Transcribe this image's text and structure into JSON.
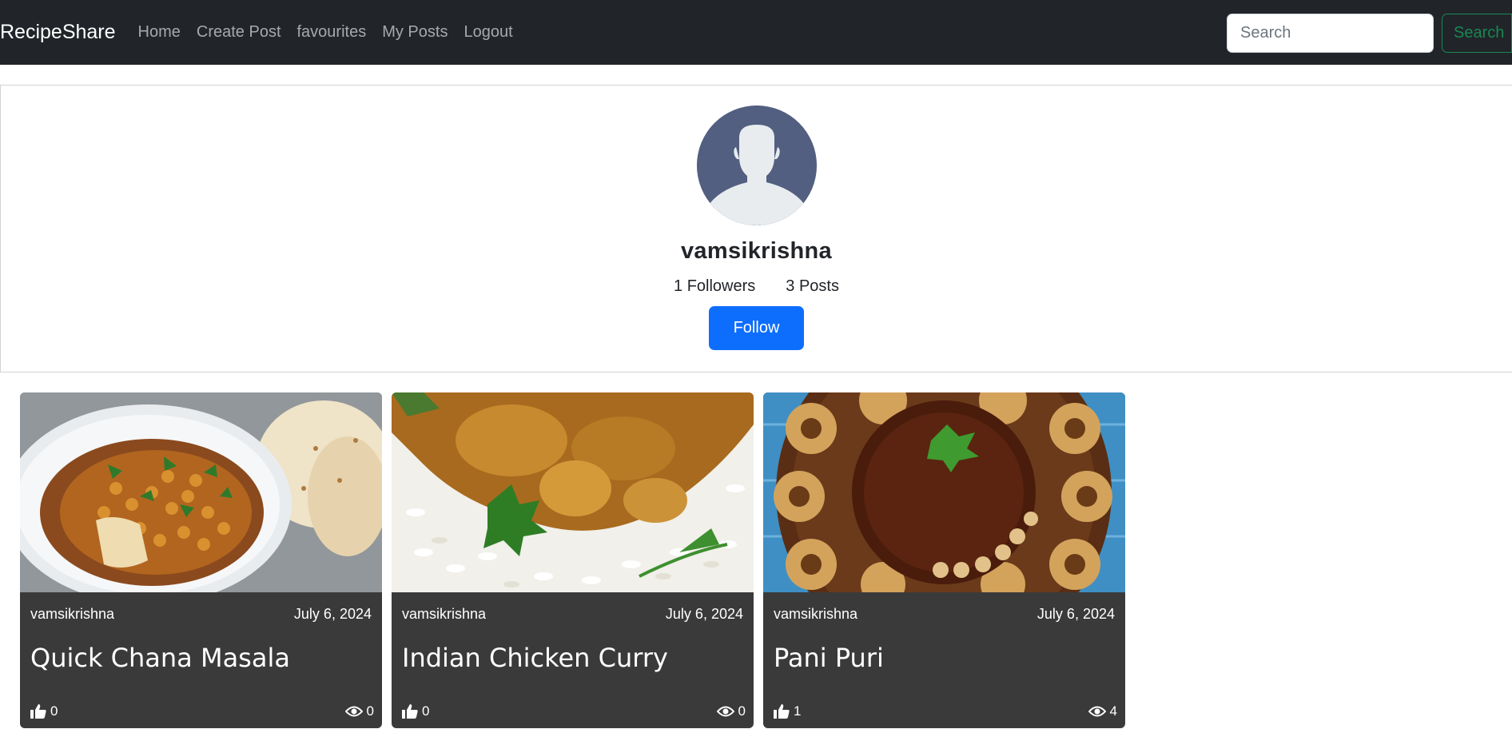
{
  "navbar": {
    "brand": "RecipeShare",
    "links": [
      "Home",
      "Create Post",
      "favourites",
      "My Posts",
      "Logout"
    ],
    "search_placeholder": "Search",
    "search_button": "Search"
  },
  "profile": {
    "username": "vamsikrishna",
    "followers": "1 Followers",
    "posts": "3 Posts",
    "follow_label": "Follow"
  },
  "posts": [
    {
      "author": "vamsikrishna",
      "date": "July 6, 2024",
      "title": "Quick Chana Masala",
      "likes": "0",
      "views": "0"
    },
    {
      "author": "vamsikrishna",
      "date": "July 6, 2024",
      "title": "Indian Chicken Curry",
      "likes": "0",
      "views": "0"
    },
    {
      "author": "vamsikrishna",
      "date": "July 6, 2024",
      "title": "Pani Puri",
      "likes": "1",
      "views": "4"
    }
  ]
}
